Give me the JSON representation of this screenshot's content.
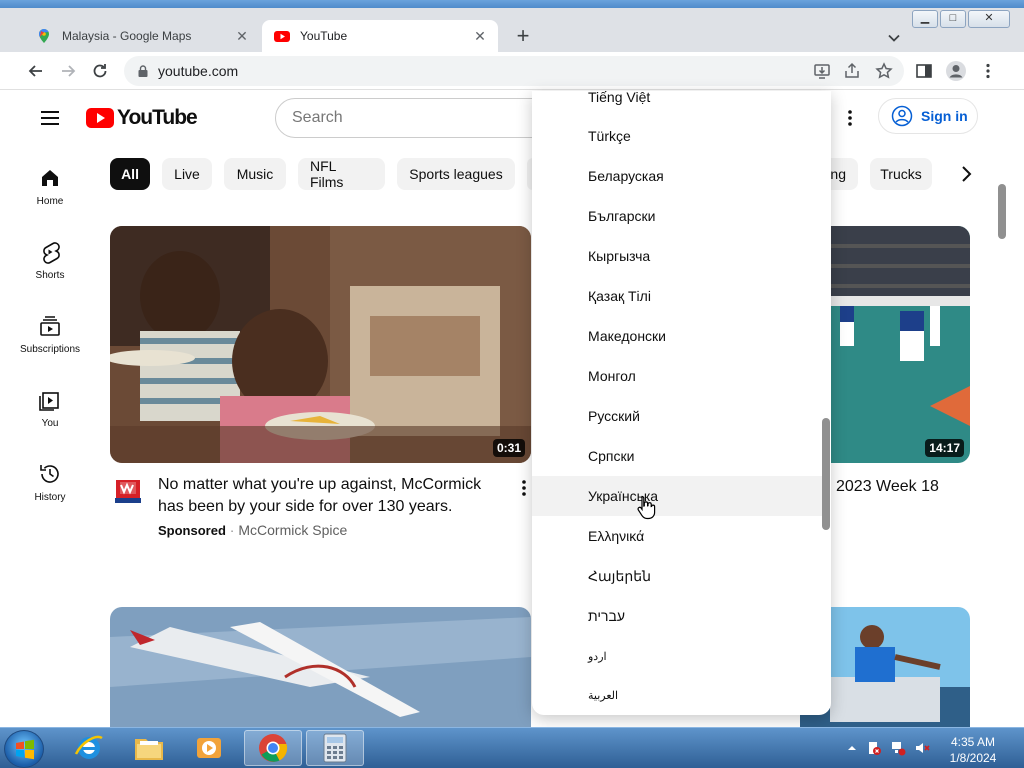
{
  "browser": {
    "tabs": [
      {
        "title": "Malaysia - Google Maps",
        "icon": "google-maps-icon",
        "active": false
      },
      {
        "title": "YouTube",
        "icon": "youtube-icon",
        "active": true
      }
    ],
    "new_tab": "+",
    "close_glyph": "✕",
    "address": "youtube.com"
  },
  "youtube": {
    "logo_text": "YouTube",
    "search_placeholder": "Search",
    "sign_in": "Sign in",
    "guide": [
      {
        "label": "Home",
        "icon": "home-icon"
      },
      {
        "label": "Shorts",
        "icon": "shorts-icon"
      },
      {
        "label": "Subscriptions",
        "icon": "subscriptions-icon"
      },
      {
        "label": "You",
        "icon": "you-icon"
      },
      {
        "label": "History",
        "icon": "history-icon"
      }
    ],
    "chips": [
      "All",
      "Live",
      "Music",
      "NFL Films",
      "Sports leagues",
      "ng",
      "Trucks"
    ],
    "videos": [
      {
        "duration": "0:31",
        "title_line1": "No matter what you're up against, McCormick",
        "title_line2": "has been by your side for over 130 years.",
        "sponsored": "Sponsored",
        "channel": "McCormick Spice"
      },
      {
        "duration": "14:17",
        "title_fragment": "2023 Week 18"
      }
    ]
  },
  "language_menu": {
    "items": [
      "Tiếng Việt",
      "Türkçe",
      "Беларуская",
      "Български",
      "Кыргызча",
      "Қазақ Тілі",
      "Македонски",
      "Монгол",
      "Русский",
      "Српски",
      "Українська",
      "Ελληνικά",
      "Հայերեն",
      "עברית",
      "اردو",
      "العربية"
    ],
    "hovered": "Українська"
  },
  "taskbar": {
    "time": "4:35 AM",
    "date": "1/8/2024"
  },
  "colors": {
    "youtube_red": "#ff0000",
    "link_blue": "#065fd4",
    "taskbar": "#2f5f95"
  }
}
